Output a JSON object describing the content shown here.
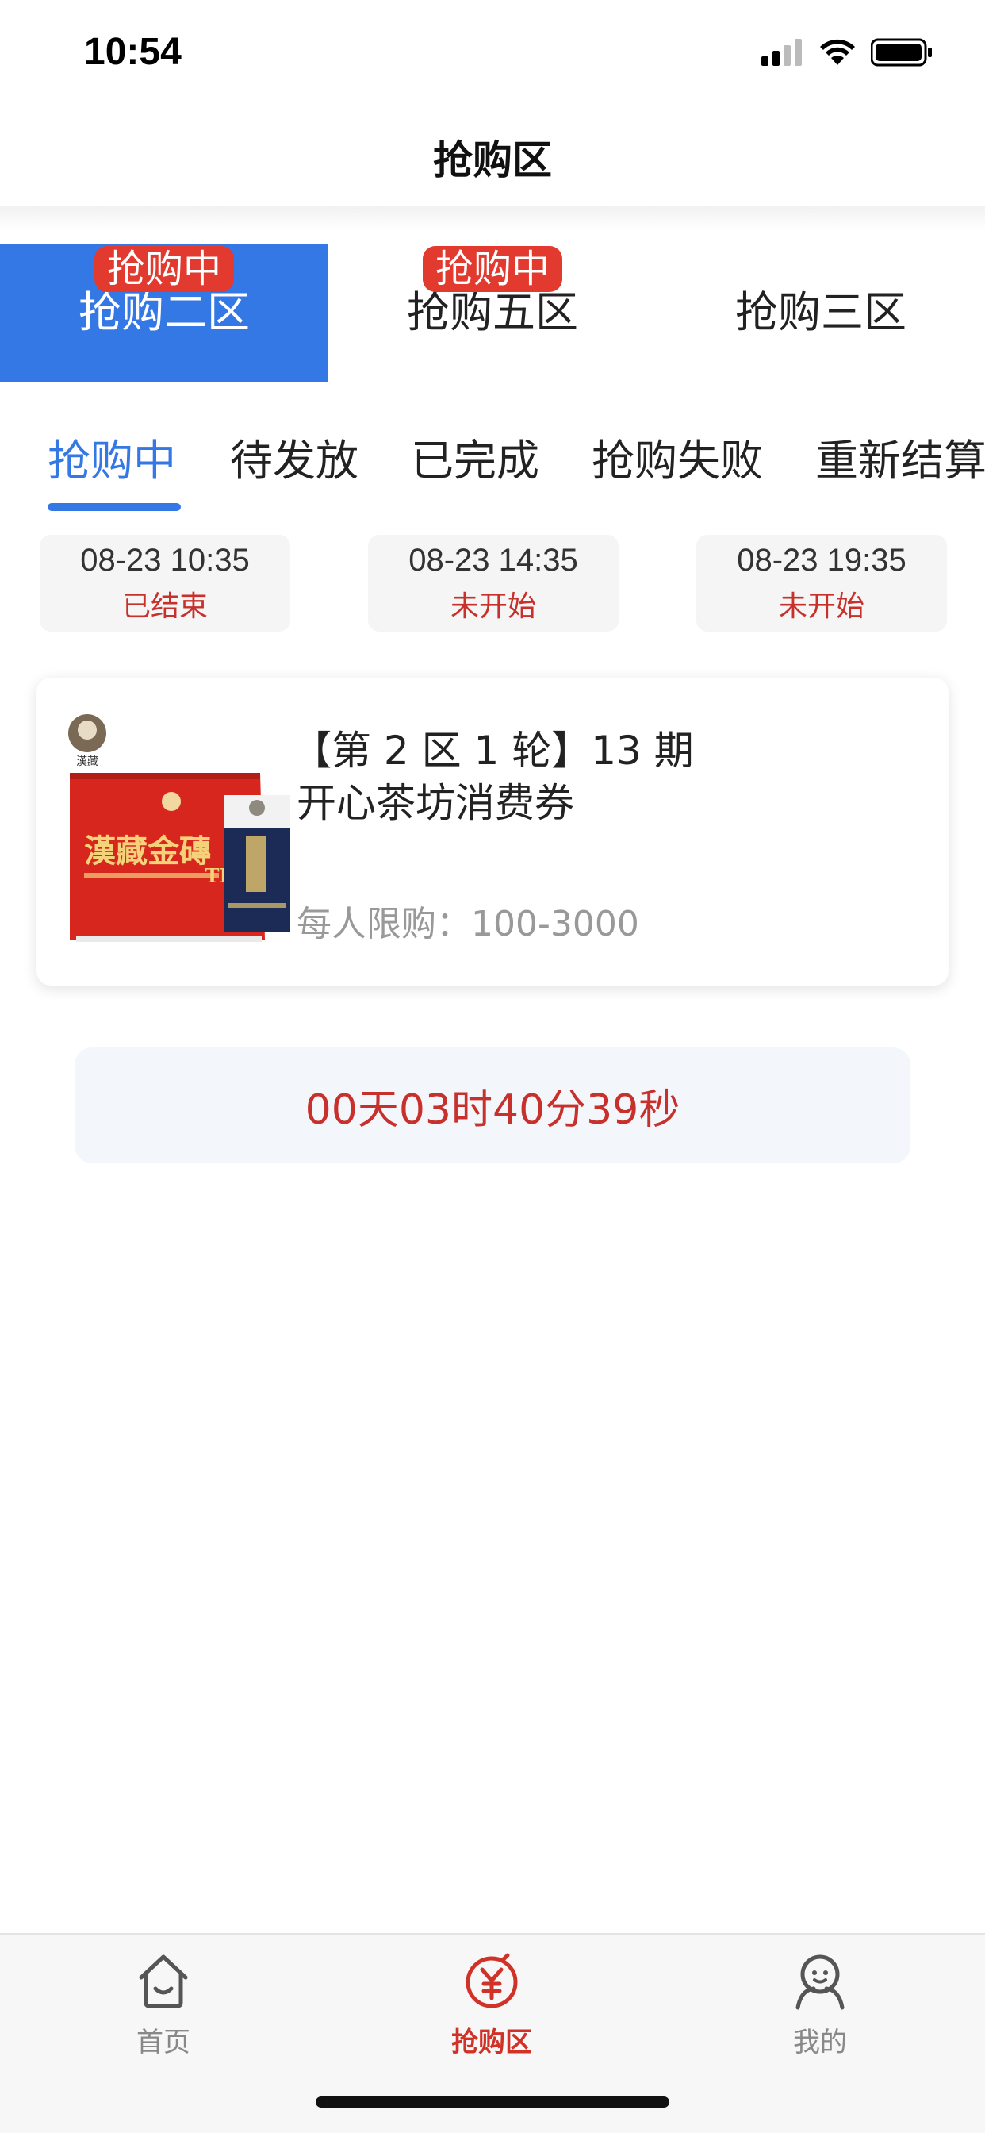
{
  "status_bar": {
    "time": "10:54"
  },
  "header": {
    "title": "抢购区"
  },
  "zone_tabs": [
    {
      "label": "抢购二区",
      "badge": "抢购中",
      "active": true
    },
    {
      "label": "抢购五区",
      "badge": "抢购中",
      "active": false
    },
    {
      "label": "抢购三区",
      "badge": "",
      "active": false
    }
  ],
  "status_tabs": [
    {
      "label": "抢购中",
      "active": true
    },
    {
      "label": "待发放",
      "active": false
    },
    {
      "label": "已完成",
      "active": false
    },
    {
      "label": "抢购失败",
      "active": false
    },
    {
      "label": "重新结算",
      "active": false
    }
  ],
  "time_slots": [
    {
      "time": "08-23 10:35",
      "status": "已结束"
    },
    {
      "time": "08-23 14:35",
      "status": "未开始"
    },
    {
      "time": "08-23 19:35",
      "status": "未开始"
    }
  ],
  "product": {
    "title": "【第 2 区 1 轮】13 期",
    "name": "开心茶坊消费券",
    "limit": "每人限购：100-3000",
    "image_label": "漢藏金磚",
    "image_sub": "TEA"
  },
  "countdown": {
    "text": "00天03时40分39秒"
  },
  "bottom_nav": [
    {
      "label": "首页",
      "icon": "home-icon",
      "active": false
    },
    {
      "label": "抢购区",
      "icon": "yuan-icon",
      "active": true
    },
    {
      "label": "我的",
      "icon": "user-icon",
      "active": false
    }
  ],
  "colors": {
    "accent_blue": "#3478e6",
    "alert_red": "#c8302b",
    "badge_red": "#e23a2e"
  }
}
